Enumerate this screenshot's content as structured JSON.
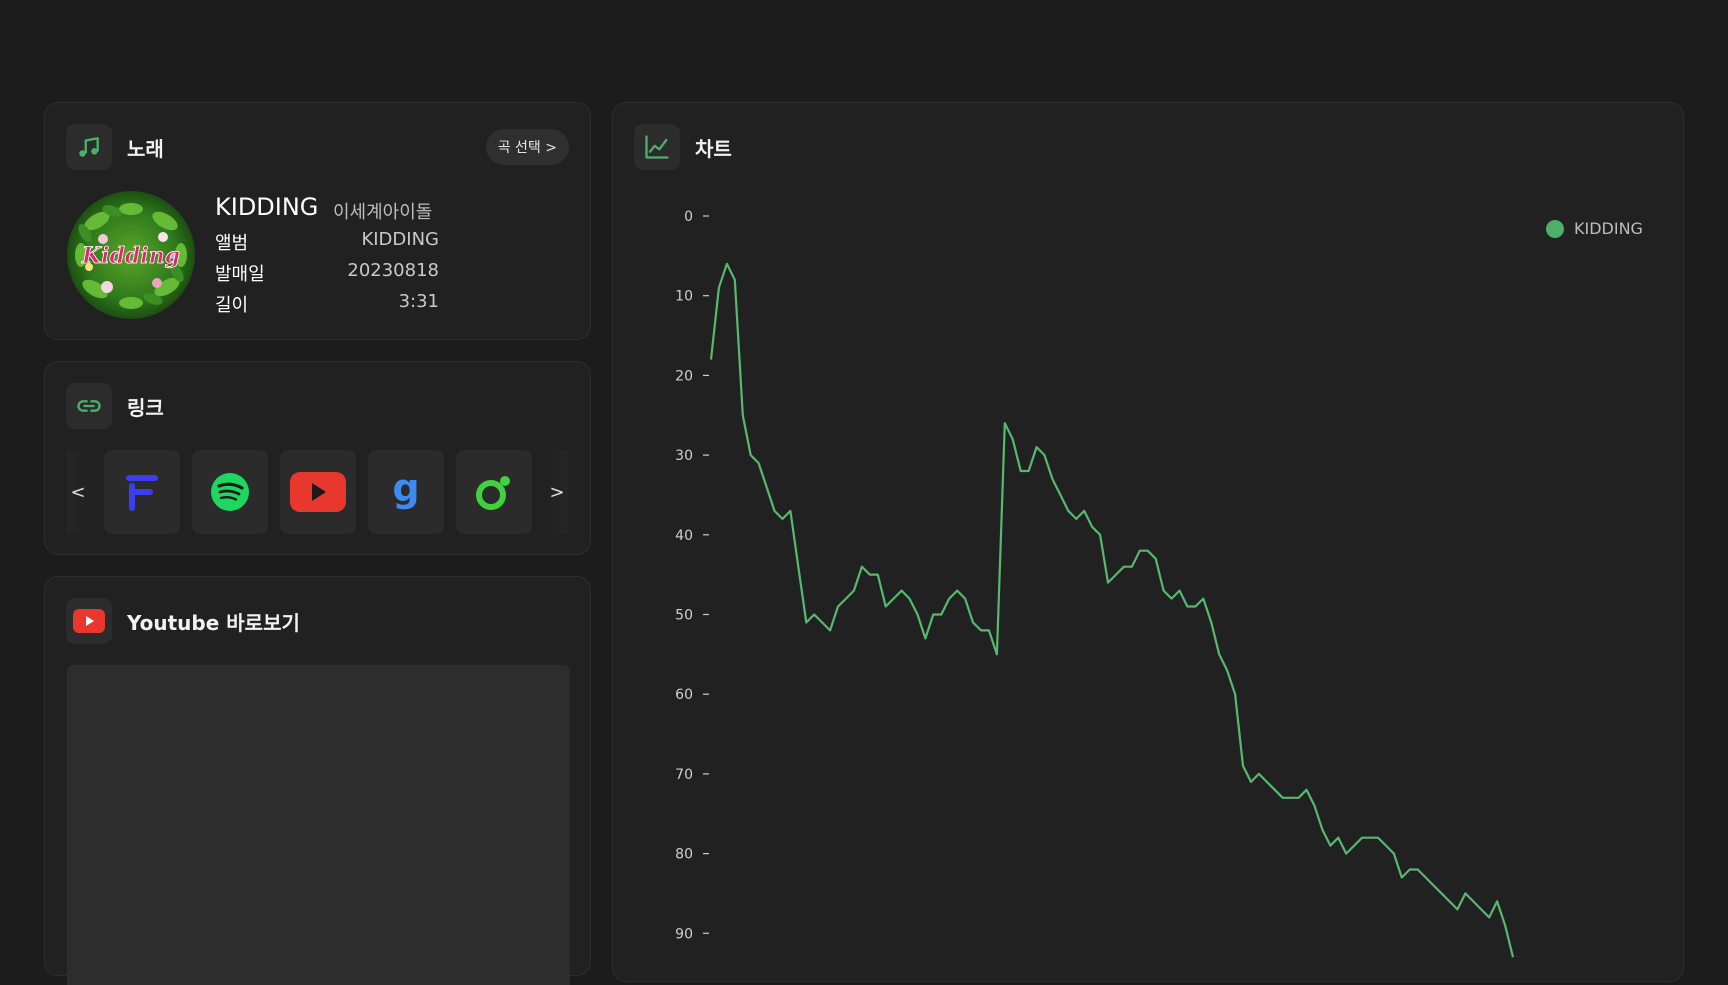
{
  "song_card": {
    "title": "노래",
    "select_button": "곡 선택 >",
    "song_title": "KIDDING",
    "artist": "이세계아이돌",
    "album_art_text": "Kidding",
    "rows": [
      {
        "label": "앨범",
        "value": "KIDDING"
      },
      {
        "label": "발매일",
        "value": "20230818"
      },
      {
        "label": "길이",
        "value": "3:31"
      }
    ]
  },
  "links_card": {
    "title": "링크",
    "prev": "<",
    "next": ">",
    "services": [
      "flo-logo",
      "spotify-logo",
      "youtube-logo",
      "genie-logo",
      "melon-logo"
    ]
  },
  "youtube_card": {
    "title": "Youtube 바로보기"
  },
  "chart_card": {
    "title": "차트"
  },
  "colors": {
    "accent_green": "#4caf6a",
    "line_green": "#57b96f",
    "youtube_red": "#e8372c",
    "flo_blue": "#3c3cf0",
    "spotify_green": "#1ed760",
    "genie_blue": "#3d8bf2",
    "melon_green": "#3fd13f"
  },
  "chart_data": {
    "type": "line",
    "yaxis_reversed": true,
    "ylim": [
      0,
      95
    ],
    "yticks": [
      0,
      10,
      20,
      30,
      40,
      50,
      60,
      70,
      80,
      90
    ],
    "legend_placement": "top-right",
    "series": [
      {
        "name": "KIDDING",
        "values": [
          18,
          9,
          6,
          8,
          25,
          30,
          31,
          34,
          37,
          38,
          37,
          44,
          51,
          50,
          51,
          52,
          49,
          48,
          47,
          44,
          45,
          45,
          49,
          48,
          47,
          48,
          50,
          53,
          50,
          50,
          48,
          47,
          48,
          51,
          52,
          52,
          55,
          26,
          28,
          32,
          32,
          29,
          30,
          33,
          35,
          37,
          38,
          37,
          39,
          40,
          46,
          45,
          44,
          44,
          42,
          42,
          43,
          47,
          48,
          47,
          49,
          49,
          48,
          51,
          55,
          57,
          60,
          69,
          71,
          70,
          71,
          72,
          73,
          73,
          73,
          72,
          74,
          77,
          79,
          78,
          80,
          79,
          78,
          78,
          78,
          79,
          80,
          83,
          82,
          82,
          83,
          84,
          85,
          86,
          87,
          85,
          86,
          87,
          88,
          86,
          89,
          93
        ]
      }
    ]
  }
}
